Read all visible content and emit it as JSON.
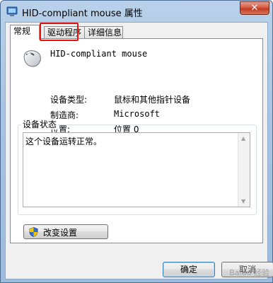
{
  "window": {
    "title": "HID-compliant mouse 属性",
    "close_label": "✕"
  },
  "tabs": [
    {
      "label": "常规",
      "active": true
    },
    {
      "label": "驱动程序",
      "active": false,
      "highlighted": true
    },
    {
      "label": "详细信息",
      "active": false
    }
  ],
  "device": {
    "icon": "mouse-icon",
    "name": "HID-compliant mouse",
    "properties": [
      {
        "label": "设备类型:",
        "value": "鼠标和其他指针设备"
      },
      {
        "label": "制造商:",
        "value": "Microsoft"
      },
      {
        "label": "位置:",
        "value": "位置 0"
      }
    ]
  },
  "status": {
    "group_label": "设备状态",
    "text": "这个设备运转正常。"
  },
  "buttons": {
    "change_settings": "改变设置",
    "ok": "确定",
    "cancel": "取消"
  },
  "watermark": "Baidu 经验",
  "colors": {
    "highlight": "#e8140c",
    "title_bar": "#b9d1ea"
  }
}
